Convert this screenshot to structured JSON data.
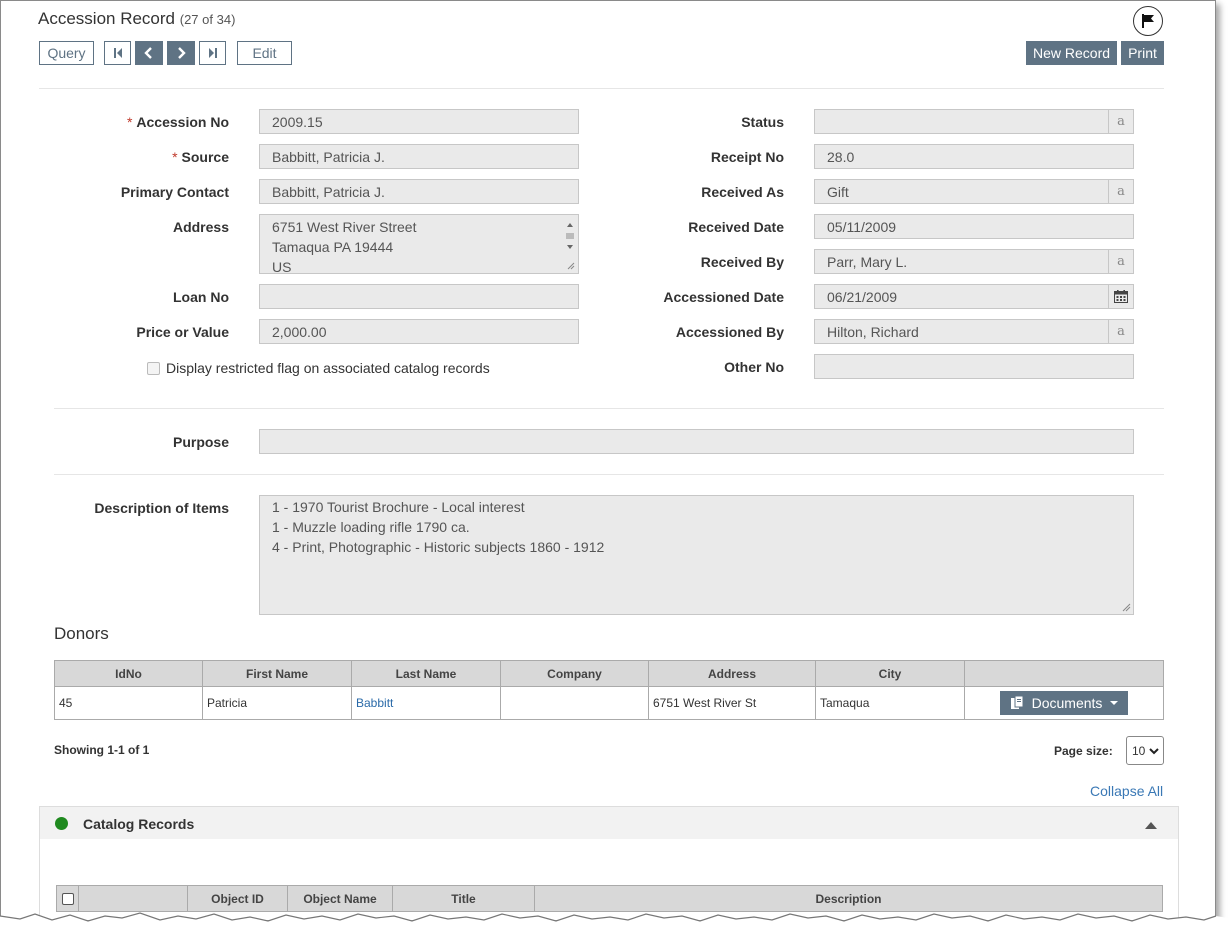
{
  "header": {
    "title": "Accession Record",
    "count": "(27 of 34)",
    "query_label": "Query",
    "edit_label": "Edit",
    "new_record_label": "New Record",
    "print_label": "Print"
  },
  "form_left": {
    "accession_no": {
      "label": "Accession No",
      "value": "2009.15",
      "required": true
    },
    "source": {
      "label": "Source",
      "value": "Babbitt, Patricia J.",
      "required": true
    },
    "primary_contact": {
      "label": "Primary Contact",
      "value": "Babbitt, Patricia J."
    },
    "address": {
      "label": "Address",
      "lines": [
        "6751 West River Street",
        "Tamaqua PA 19444",
        "US"
      ]
    },
    "loan_no": {
      "label": "Loan No",
      "value": ""
    },
    "price_or_value": {
      "label": "Price or Value",
      "value": "2,000.00"
    },
    "restricted_flag": {
      "label": "Display restricted flag on associated catalog records",
      "checked": false
    }
  },
  "form_right": {
    "status": {
      "label": "Status",
      "value": ""
    },
    "receipt_no": {
      "label": "Receipt No",
      "value": "28.0"
    },
    "received_as": {
      "label": "Received As",
      "value": "Gift"
    },
    "received_date": {
      "label": "Received Date",
      "value": "05/11/2009"
    },
    "received_by": {
      "label": "Received By",
      "value": "Parr, Mary L."
    },
    "accessioned_date": {
      "label": "Accessioned Date",
      "value": "06/21/2009"
    },
    "accessioned_by": {
      "label": "Accessioned By",
      "value": "Hilton, Richard"
    },
    "other_no": {
      "label": "Other No",
      "value": ""
    }
  },
  "purpose": {
    "label": "Purpose",
    "value": ""
  },
  "description": {
    "label": "Description of Items",
    "lines": [
      "1 - 1970 Tourist Brochure - Local interest",
      "1 - Muzzle loading rifle 1790 ca.",
      "4 - Print, Photographic - Historic subjects 1860 - 1912"
    ]
  },
  "donors": {
    "title": "Donors",
    "columns": [
      "IdNo",
      "First Name",
      "Last Name",
      "Company",
      "Address",
      "City",
      ""
    ],
    "rows": [
      {
        "idno": "45",
        "first_name": "Patricia",
        "last_name": "Babbitt",
        "company": "",
        "address": "6751 West River St",
        "city": "Tamaqua",
        "action": "Documents"
      }
    ],
    "showing": "Showing 1-1 of 1",
    "page_size_label": "Page size:",
    "page_size_value": "10"
  },
  "collapse_all": "Collapse All",
  "catalog": {
    "title": "Catalog Records",
    "status_color": "#1f8a1f",
    "columns": [
      "",
      "",
      "Object ID",
      "Object Name",
      "Title",
      "Description"
    ]
  },
  "icons": {
    "suffix_glyph": "a"
  },
  "colors": {
    "button": "#5f7384",
    "link": "#2a6aa8",
    "required": "#c0392b"
  }
}
